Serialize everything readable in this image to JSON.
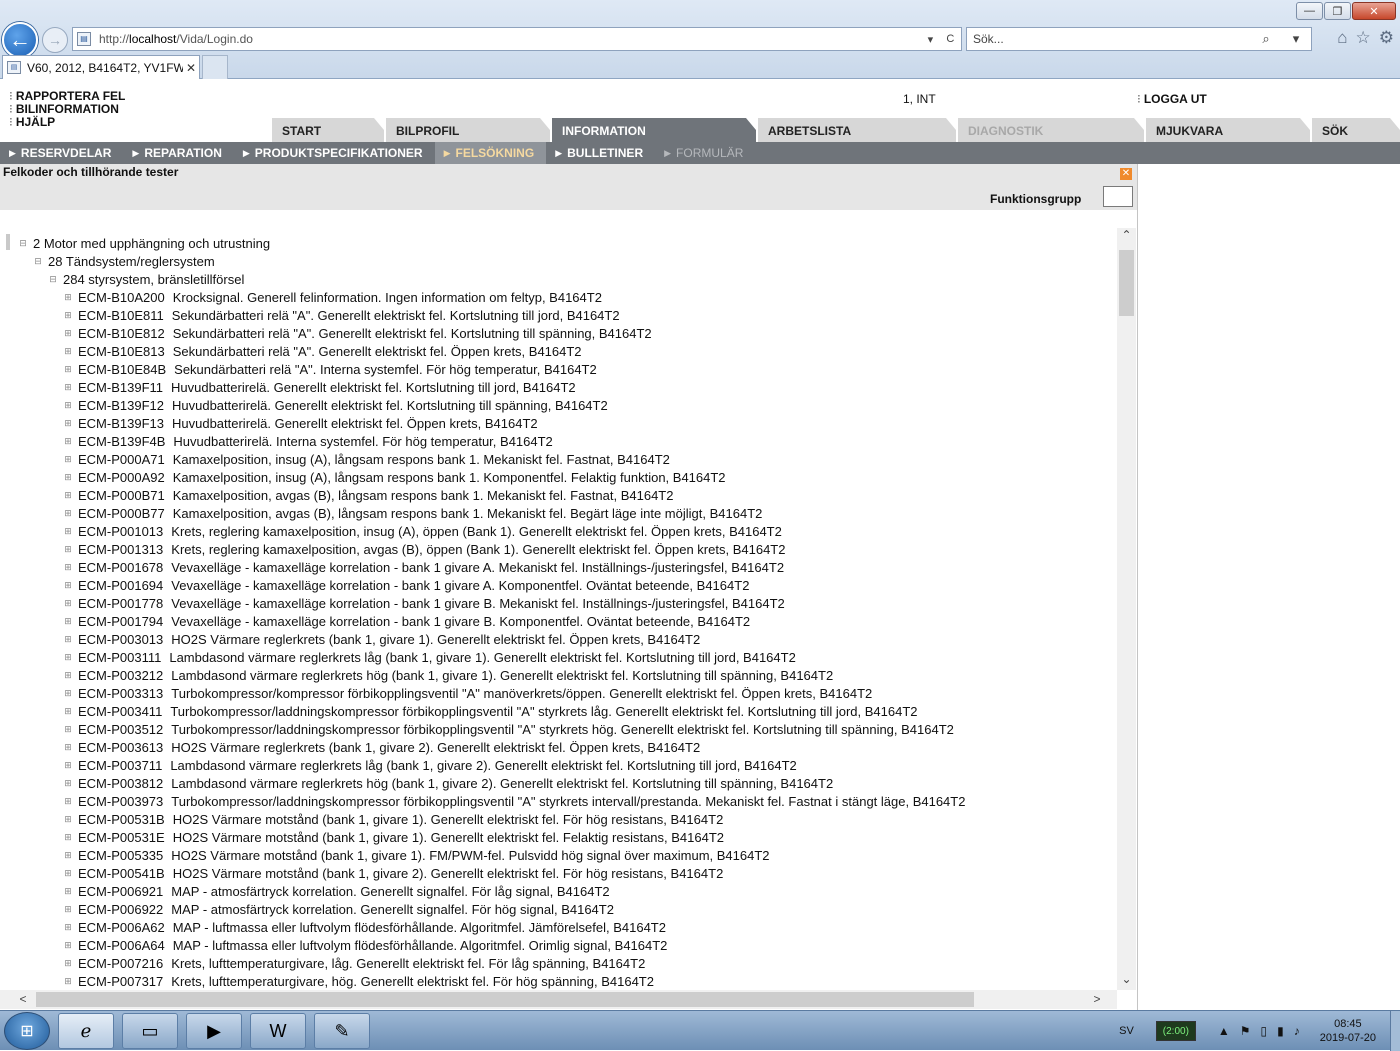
{
  "browser": {
    "window_controls": [
      "—",
      "❐",
      "✕"
    ],
    "url_host_prefix": "http://",
    "url_host": "localhost",
    "url_path": "/Vida/Login.do",
    "address_tools": [
      "▾",
      "C"
    ],
    "search_placeholder": "Sök...",
    "search_tools": [
      "⌕",
      "▾"
    ],
    "tab_title": "V60, 2012, B4164T2, YV1FW...",
    "tab_close": "✕",
    "icons": [
      "home-icon",
      "favorites-star-icon",
      "settings-gear-icon"
    ]
  },
  "header": {
    "links": [
      "RAPPORTERA FEL",
      "BILINFORMATION",
      "HJÄLP"
    ],
    "user_info": "1, INT",
    "logout": "LOGGA UT"
  },
  "main_tabs": [
    {
      "label": "START",
      "state": "normal"
    },
    {
      "label": "BILPROFIL",
      "state": "normal"
    },
    {
      "label": "INFORMATION",
      "state": "active"
    },
    {
      "label": "ARBETSLISTA",
      "state": "normal"
    },
    {
      "label": "DIAGNOSTIK",
      "state": "disabled"
    },
    {
      "label": "MJUKVARA",
      "state": "normal"
    },
    {
      "label": "SÖK",
      "state": "normal"
    }
  ],
  "sub_tabs": [
    {
      "label": "RESERVDELAR",
      "state": "normal"
    },
    {
      "label": "REPARATION",
      "state": "normal"
    },
    {
      "label": "PRODUKTSPECIFIKATIONER",
      "state": "normal"
    },
    {
      "label": "FELSÖKNING",
      "state": "active"
    },
    {
      "label": "BULLETINER",
      "state": "normal"
    },
    {
      "label": "FORMULÄR",
      "state": "disabled"
    }
  ],
  "content": {
    "section_title": "Felkoder och tillhörande tester",
    "function_group_label": "Funktionsgrupp",
    "function_group_value": ""
  },
  "tree": {
    "level1": "2 Motor med upphängning och utrustning",
    "level2": "28 Tändsystem/reglersystem",
    "level3": "284 styrsystem, bränsletillförsel",
    "items": [
      {
        "code": "ECM-B10A200",
        "desc": "Krocksignal.  Generell felinformation.  Ingen information om feltyp, B4164T2"
      },
      {
        "code": "ECM-B10E811",
        "desc": "Sekundärbatteri relä \"A\".  Generellt elektriskt fel.  Kortslutning till jord, B4164T2"
      },
      {
        "code": "ECM-B10E812",
        "desc": "Sekundärbatteri relä \"A\".  Generellt elektriskt fel.  Kortslutning till spänning, B4164T2"
      },
      {
        "code": "ECM-B10E813",
        "desc": "Sekundärbatteri relä \"A\".  Generellt elektriskt fel.  Öppen krets, B4164T2"
      },
      {
        "code": "ECM-B10E84B",
        "desc": "Sekundärbatteri relä \"A\".  Interna systemfel.  För hög temperatur, B4164T2"
      },
      {
        "code": "ECM-B139F11",
        "desc": "Huvudbatterirelä.  Generellt elektriskt fel.  Kortslutning till jord, B4164T2"
      },
      {
        "code": "ECM-B139F12",
        "desc": "Huvudbatterirelä.  Generellt elektriskt fel.  Kortslutning till spänning, B4164T2"
      },
      {
        "code": "ECM-B139F13",
        "desc": "Huvudbatterirelä.  Generellt elektriskt fel.  Öppen krets, B4164T2"
      },
      {
        "code": "ECM-B139F4B",
        "desc": "Huvudbatterirelä.  Interna systemfel.  För hög temperatur, B4164T2"
      },
      {
        "code": "ECM-P000A71",
        "desc": "Kamaxelposition, insug (A), långsam respons bank 1.  Mekaniskt fel.  Fastnat, B4164T2"
      },
      {
        "code": "ECM-P000A92",
        "desc": "Kamaxelposition, insug (A), långsam respons bank 1.  Komponentfel.  Felaktig funktion, B4164T2"
      },
      {
        "code": "ECM-P000B71",
        "desc": "Kamaxelposition, avgas (B), långsam respons bank 1.  Mekaniskt fel.  Fastnat, B4164T2"
      },
      {
        "code": "ECM-P000B77",
        "desc": "Kamaxelposition, avgas (B), långsam respons bank 1.  Mekaniskt fel.  Begärt läge inte möjligt, B4164T2"
      },
      {
        "code": "ECM-P001013",
        "desc": "Krets, reglering kamaxelposition, insug (A), öppen (Bank 1).  Generellt elektriskt fel.  Öppen krets, B4164T2"
      },
      {
        "code": "ECM-P001313",
        "desc": "Krets, reglering kamaxelposition, avgas (B), öppen (Bank 1).  Generellt elektriskt fel.  Öppen krets, B4164T2"
      },
      {
        "code": "ECM-P001678",
        "desc": "Vevaxelläge - kamaxelläge korrelation - bank 1 givare A.  Mekaniskt fel.  Inställnings-/justeringsfel, B4164T2"
      },
      {
        "code": "ECM-P001694",
        "desc": "Vevaxelläge - kamaxelläge korrelation - bank 1 givare A.  Komponentfel.  Oväntat beteende, B4164T2"
      },
      {
        "code": "ECM-P001778",
        "desc": "Vevaxelläge - kamaxelläge korrelation - bank 1 givare B.  Mekaniskt fel.  Inställnings-/justeringsfel, B4164T2"
      },
      {
        "code": "ECM-P001794",
        "desc": "Vevaxelläge - kamaxelläge korrelation - bank 1 givare B.  Komponentfel.  Oväntat beteende, B4164T2"
      },
      {
        "code": "ECM-P003013",
        "desc": "HO2S Värmare reglerkrets (bank 1, givare 1).  Generellt elektriskt fel.  Öppen krets, B4164T2"
      },
      {
        "code": "ECM-P003111",
        "desc": "Lambdasond värmare reglerkrets låg (bank 1, givare 1).  Generellt elektriskt fel.  Kortslutning till jord, B4164T2"
      },
      {
        "code": "ECM-P003212",
        "desc": "Lambdasond värmare reglerkrets hög (bank 1, givare 1).  Generellt elektriskt fel.  Kortslutning till spänning, B4164T2"
      },
      {
        "code": "ECM-P003313",
        "desc": "Turbokompressor/kompressor förbikopplingsventil \"A\" manöverkrets/öppen.  Generellt elektriskt fel.  Öppen krets, B4164T2"
      },
      {
        "code": "ECM-P003411",
        "desc": "Turbokompressor/laddningskompressor förbikopplingsventil \"A\" styrkrets låg.  Generellt elektriskt fel.  Kortslutning till jord, B4164T2"
      },
      {
        "code": "ECM-P003512",
        "desc": "Turbokompressor/laddningskompressor förbikopplingsventil \"A\" styrkrets hög.  Generellt elektriskt fel.  Kortslutning till spänning, B4164T2"
      },
      {
        "code": "ECM-P003613",
        "desc": "HO2S Värmare reglerkrets (bank 1, givare 2).  Generellt elektriskt fel.  Öppen krets, B4164T2"
      },
      {
        "code": "ECM-P003711",
        "desc": "Lambdasond värmare reglerkrets låg (bank 1, givare 2).  Generellt elektriskt fel.  Kortslutning till jord, B4164T2"
      },
      {
        "code": "ECM-P003812",
        "desc": "Lambdasond värmare reglerkrets hög (bank 1, givare 2).  Generellt elektriskt fel.  Kortslutning till spänning, B4164T2"
      },
      {
        "code": "ECM-P003973",
        "desc": "Turbokompressor/laddningskompressor förbikopplingsventil \"A\" styrkrets intervall/prestanda.  Mekaniskt fel.  Fastnat i stängt läge, B4164T2"
      },
      {
        "code": "ECM-P00531B",
        "desc": "HO2S Värmare motstånd (bank 1, givare 1).  Generellt elektriskt fel.  För hög resistans, B4164T2"
      },
      {
        "code": "ECM-P00531E",
        "desc": "HO2S Värmare motstånd (bank 1, givare 1).  Generellt elektriskt fel.  Felaktig resistans, B4164T2"
      },
      {
        "code": "ECM-P005335",
        "desc": "HO2S Värmare motstånd (bank 1, givare 1).  FM/PWM-fel.  Pulsvidd hög signal över maximum, B4164T2"
      },
      {
        "code": "ECM-P00541B",
        "desc": "HO2S Värmare motstånd (bank 1, givare 2).  Generellt elektriskt fel.  För hög resistans, B4164T2"
      },
      {
        "code": "ECM-P006921",
        "desc": "MAP - atmosfärtryck korrelation.  Generellt signalfel.  För låg signal, B4164T2"
      },
      {
        "code": "ECM-P006922",
        "desc": "MAP - atmosfärtryck korrelation.  Generellt signalfel.  För hög signal, B4164T2"
      },
      {
        "code": "ECM-P006A62",
        "desc": "MAP - luftmassa eller luftvolym flödesförhållande.  Algoritmfel.  Jämförelsefel, B4164T2"
      },
      {
        "code": "ECM-P006A64",
        "desc": "MAP - luftmassa eller luftvolym flödesförhållande.  Algoritmfel.  Orimlig signal, B4164T2"
      },
      {
        "code": "ECM-P007216",
        "desc": "Krets, lufttemperaturgivare, låg.  Generellt elektriskt fel.  För låg spänning, B4164T2"
      },
      {
        "code": "ECM-P007317",
        "desc": "Krets, lufttemperaturgivare, hög.  Generellt elektriskt fel.  För hög spänning, B4164T2"
      }
    ]
  },
  "scrollbars": {
    "vertical": {
      "up": "⌃",
      "down": "⌄",
      "position": 0.02
    },
    "horizontal": {
      "left": "<",
      "right": ">",
      "position": 0.0
    }
  },
  "taskbar": {
    "apps": [
      "internet-explorer-icon",
      "file-explorer-icon",
      "media-player-icon",
      "word-icon",
      "paint-icon"
    ],
    "language": "SV",
    "battery_timer": "(2:00)",
    "time": "08:45",
    "date": "2019-07-20"
  }
}
